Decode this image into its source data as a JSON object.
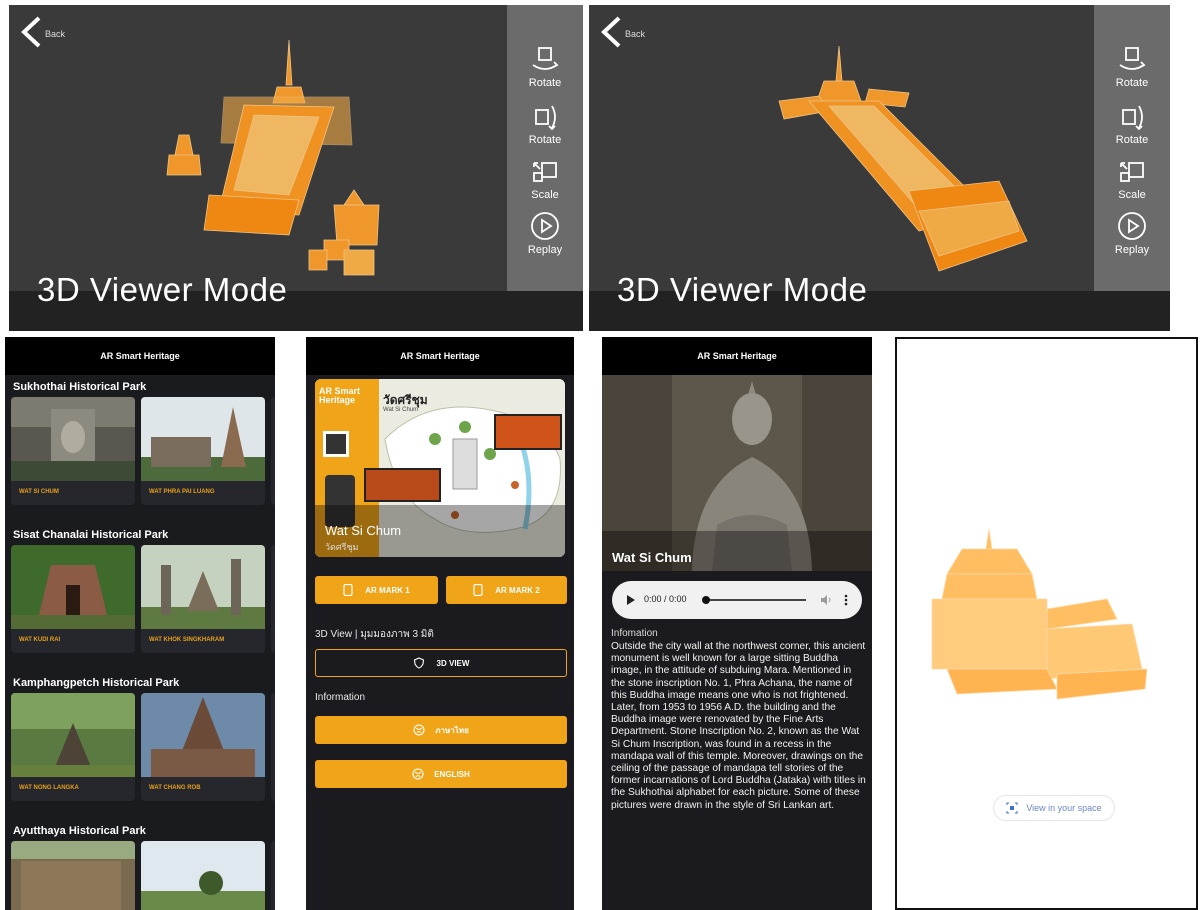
{
  "viewers": [
    {
      "back_label": "Back",
      "title": "3D Viewer Mode",
      "tools": [
        {
          "label": "Rotate",
          "icon": "rotate-horizontal-icon"
        },
        {
          "label": "Rotate",
          "icon": "rotate-vertical-icon"
        },
        {
          "label": "Scale",
          "icon": "scale-icon"
        },
        {
          "label": "Replay",
          "icon": "replay-icon"
        }
      ]
    },
    {
      "back_label": "Back",
      "title": "3D Viewer Mode",
      "tools": [
        {
          "label": "Rotate",
          "icon": "rotate-horizontal-icon"
        },
        {
          "label": "Rotate",
          "icon": "rotate-vertical-icon"
        },
        {
          "label": "Scale",
          "icon": "scale-icon"
        },
        {
          "label": "Replay",
          "icon": "replay-icon"
        }
      ]
    }
  ],
  "app_title": "AR Smart Heritage",
  "parks": [
    {
      "name": "Sukhothai Historical Park",
      "sites": [
        "WAT SI CHUM",
        "WAT PHRA PAI LUANG"
      ]
    },
    {
      "name": "Sisat Chanalai Historical Park",
      "sites": [
        "WAT KUDI RAI",
        "WAT KHOK SINGKHARAM"
      ]
    },
    {
      "name": "Kamphangpetch Historical Park",
      "sites": [
        "WAT NONG LANGKA",
        "WAT CHANG ROB"
      ]
    },
    {
      "name": "Ayutthaya Historical Park",
      "sites": [
        "",
        ""
      ]
    }
  ],
  "detail": {
    "map_title_thai": "วัดศรีชุม",
    "map_title_en": "Wat Si Chum",
    "poster_brand": "AR Smart Heritage",
    "site_name": "Wat Si Chum",
    "site_name_thai": "วัดศรีชุม",
    "ar_mark_1": "AR MARK 1",
    "ar_mark_2": "AR MARK 2",
    "view_section": "3D View | มุมมองภาพ 3 มิติ",
    "view_button": "3D VIEW",
    "info_section": "Information",
    "thai_button": "ภาษาไทย",
    "english_button": "ENGLISH"
  },
  "info_page": {
    "site_name": "Wat Si Chum",
    "audio_time": "0:00 / 0:00",
    "audio_progress": 0,
    "info_heading": "Infomation",
    "info_body": "Outside the city wall at the northwest corner, this ancient monument is well known for a large sitting Buddha image, in the attitude of subduing Mara. Mentioned in the stone inscription No. 1, Phra Achana, the name of this Buddha image means one who is not frightened. Later, from 1953 to 1956 A.D. the building and the Buddha image were renovated by the Fine Arts Department. Stone Inscription No. 2, known as the Wat Si Chum Inscription, was found in a recess in the mandapa wall of this temple. Moreover, drawings on the ceiling of the passage of mandapa tell stories of the former incarnations of Lord Buddha (Jataka) with titles in the Sukhothai alphabet for each picture. Some of these pictures were drawn in the style of Sri Lankan art."
  },
  "ar_view": {
    "button_label": "View in your space",
    "icon": "ar-cube-icon"
  },
  "colors": {
    "accent": "#f0a418",
    "model_orange": "#ffa733",
    "viewer_bg": "#3a3a3a",
    "dark_bg": "#1b1b1f"
  }
}
